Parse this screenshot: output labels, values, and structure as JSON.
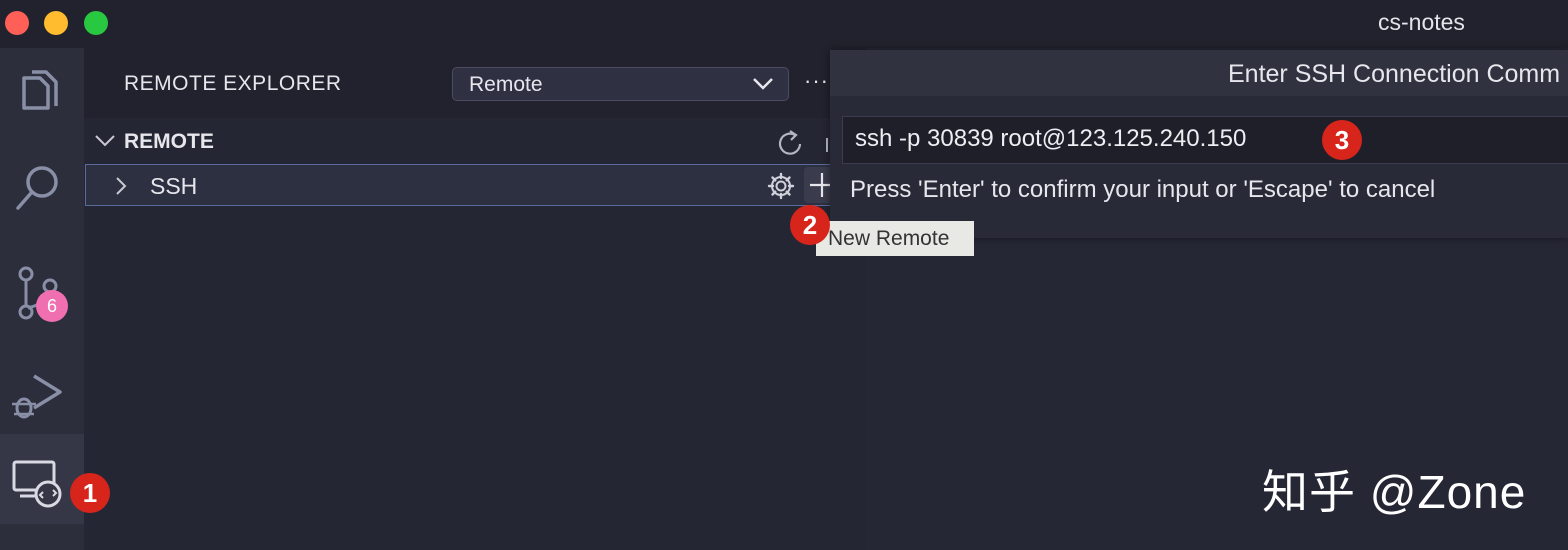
{
  "window": {
    "title": "cs-notes"
  },
  "activity_bar": {
    "items": [
      {
        "icon": "files-icon"
      },
      {
        "icon": "search-icon"
      },
      {
        "icon": "source-control-icon",
        "badge": "6"
      },
      {
        "icon": "run-debug-icon"
      },
      {
        "icon": "remote-explorer-icon",
        "active": true
      }
    ]
  },
  "sidebar": {
    "title": "REMOTE EXPLORER",
    "dropdown_value": "Remote",
    "more_label": "···",
    "section": {
      "title": "REMOTE",
      "items": [
        {
          "label": "SSH"
        }
      ]
    }
  },
  "markers": {
    "one": "1",
    "two": "2",
    "three": "3"
  },
  "tooltip": {
    "text": "New Remote"
  },
  "quick_input": {
    "title": "Enter SSH Connection Comm",
    "value": "ssh -p 30839 root@123.125.240.150",
    "hint": "Press 'Enter' to confirm your input or 'Escape' to cancel"
  },
  "watermark": {
    "text": "知乎 @Zone"
  },
  "colors": {
    "marker_red": "#d7251c",
    "badge_pink": "#f06fb0",
    "selection_border": "#5d6a9c"
  }
}
